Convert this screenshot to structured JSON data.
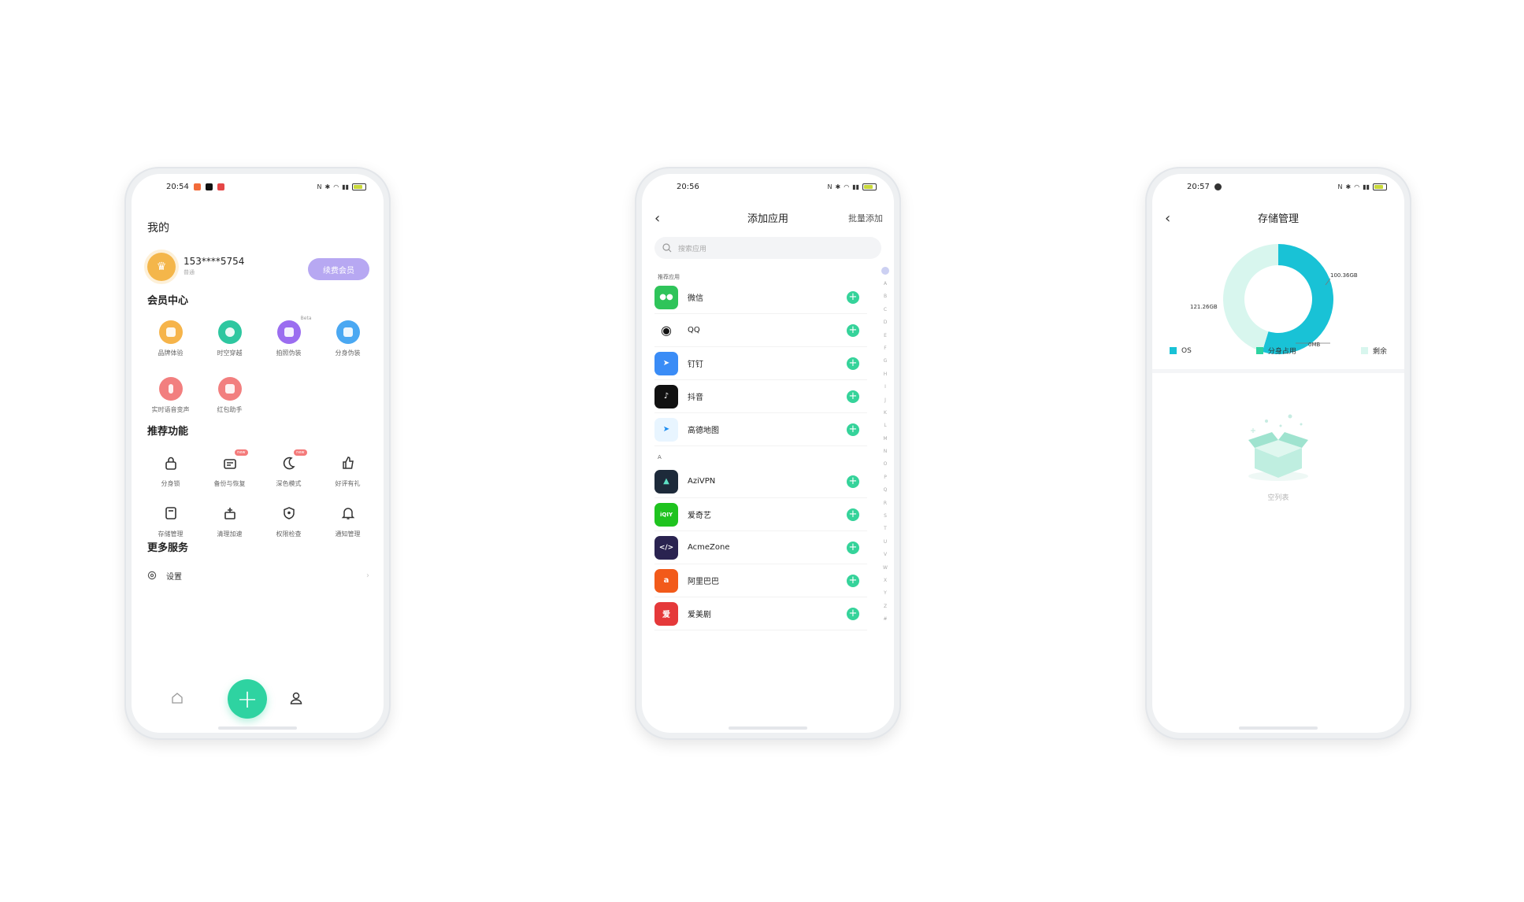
{
  "phone1": {
    "status_time": "20:54",
    "page_title": "我的",
    "user": {
      "phone": "153****5754",
      "sub": "普通"
    },
    "vip_button": "续费会员",
    "member_center": {
      "title": "会员中心",
      "items": [
        {
          "label": "品牌体验",
          "color": "#f6b44a",
          "icon": "phone-icon"
        },
        {
          "label": "时空穿越",
          "color": "#2ec7a0",
          "icon": "location-pin-icon"
        },
        {
          "label": "拍照伪装",
          "color": "#9b6df0",
          "icon": "camera-icon",
          "tag": "Beta"
        },
        {
          "label": "分身伪装",
          "color": "#4aa8f2",
          "icon": "mask-icon"
        },
        {
          "label": "实时语音变声",
          "color": "#f27f7f",
          "icon": "microphone-icon"
        },
        {
          "label": "红包助手",
          "color": "#f27f7f",
          "icon": "red-packet-icon"
        }
      ]
    },
    "recommended": {
      "title": "推荐功能",
      "items": [
        {
          "label": "分身锁",
          "icon": "lock-icon"
        },
        {
          "label": "备份与恢复",
          "icon": "backup-icon",
          "badge": "new"
        },
        {
          "label": "深色模式",
          "icon": "moon-icon",
          "badge": "new"
        },
        {
          "label": "好评有礼",
          "icon": "thumbs-up-icon"
        },
        {
          "label": "存储管理",
          "icon": "storage-icon"
        },
        {
          "label": "清理加速",
          "icon": "broom-icon"
        },
        {
          "label": "权限检查",
          "icon": "shield-icon"
        },
        {
          "label": "通知管理",
          "icon": "bell-icon"
        }
      ]
    },
    "more_services": {
      "title": "更多服务",
      "settings_label": "设置"
    }
  },
  "phone2": {
    "status_time": "20:56",
    "nav_title": "添加应用",
    "nav_action": "批量添加",
    "search_placeholder": "搜索应用",
    "recommended_label": "推荐应用",
    "section_a_label": "A",
    "recommended_apps": [
      {
        "name": "微信",
        "color": "#2fc45a",
        "glyph": "💬"
      },
      {
        "name": "QQ",
        "color": "#ffffff",
        "glyph": "🐧"
      },
      {
        "name": "钉钉",
        "color": "#3a8cf6",
        "glyph": "➤"
      },
      {
        "name": "抖音",
        "color": "#111111",
        "glyph": "♪"
      },
      {
        "name": "高德地图",
        "color": "#e8f5ff",
        "glyph": "➤"
      }
    ],
    "a_apps": [
      {
        "name": "AziVPN",
        "color": "#1d2a3a",
        "glyph": "▲"
      },
      {
        "name": "爱奇艺",
        "color": "#1fc31f",
        "glyph": "iQIY"
      },
      {
        "name": "AcmeZone",
        "color": "#2a2350",
        "glyph": "</>"
      },
      {
        "name": "阿里巴巴",
        "color": "#f25a1a",
        "glyph": "a"
      },
      {
        "name": "爱美剧",
        "color": "#e5393a",
        "glyph": "爱"
      }
    ],
    "alphabet": [
      "A",
      "B",
      "C",
      "D",
      "E",
      "F",
      "G",
      "H",
      "I",
      "J",
      "K",
      "L",
      "M",
      "N",
      "O",
      "P",
      "Q",
      "R",
      "S",
      "T",
      "U",
      "V",
      "W",
      "X",
      "Y",
      "Z",
      "#"
    ]
  },
  "phone3": {
    "status_time": "20:57",
    "nav_title": "存储管理",
    "chart_data": {
      "type": "pie",
      "labels": [
        "OS",
        "分身占用",
        "剩余"
      ],
      "values": [
        121.26,
        0,
        100.36
      ],
      "value_labels": [
        "121.26GB",
        "0MB",
        "100.36GB"
      ],
      "colors": [
        "#19c2d6",
        "#2ed3a1",
        "#d8f6ee"
      ]
    },
    "legend": [
      "OS",
      "分身占用",
      "剩余"
    ],
    "empty_text": "空列表"
  }
}
